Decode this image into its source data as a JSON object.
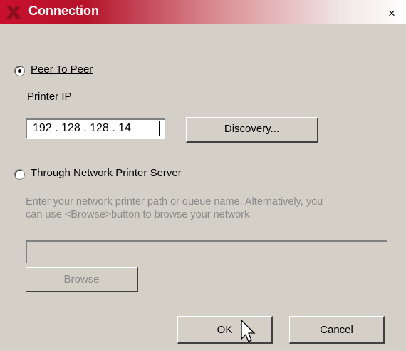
{
  "window": {
    "title": "Connection",
    "close_label": "×"
  },
  "peer": {
    "label": "Peer To Peer",
    "selected": true,
    "printer_ip_label": "Printer IP",
    "ip_value": "192 . 128 . 128 .  14",
    "discovery_label": "Discovery..."
  },
  "server": {
    "label": "Through Network Printer Server",
    "selected": false,
    "instruction_line1": "Enter your network printer path or queue name. Alternatively, you",
    "instruction_line2": "can use <Browse>button to browse your network.",
    "path_value": "",
    "browse_label": "Browse"
  },
  "actions": {
    "ok_label": "OK",
    "cancel_label": "Cancel"
  },
  "colors": {
    "title_accent": "#c8102e",
    "dialog_bg": "#d4d0c8"
  }
}
